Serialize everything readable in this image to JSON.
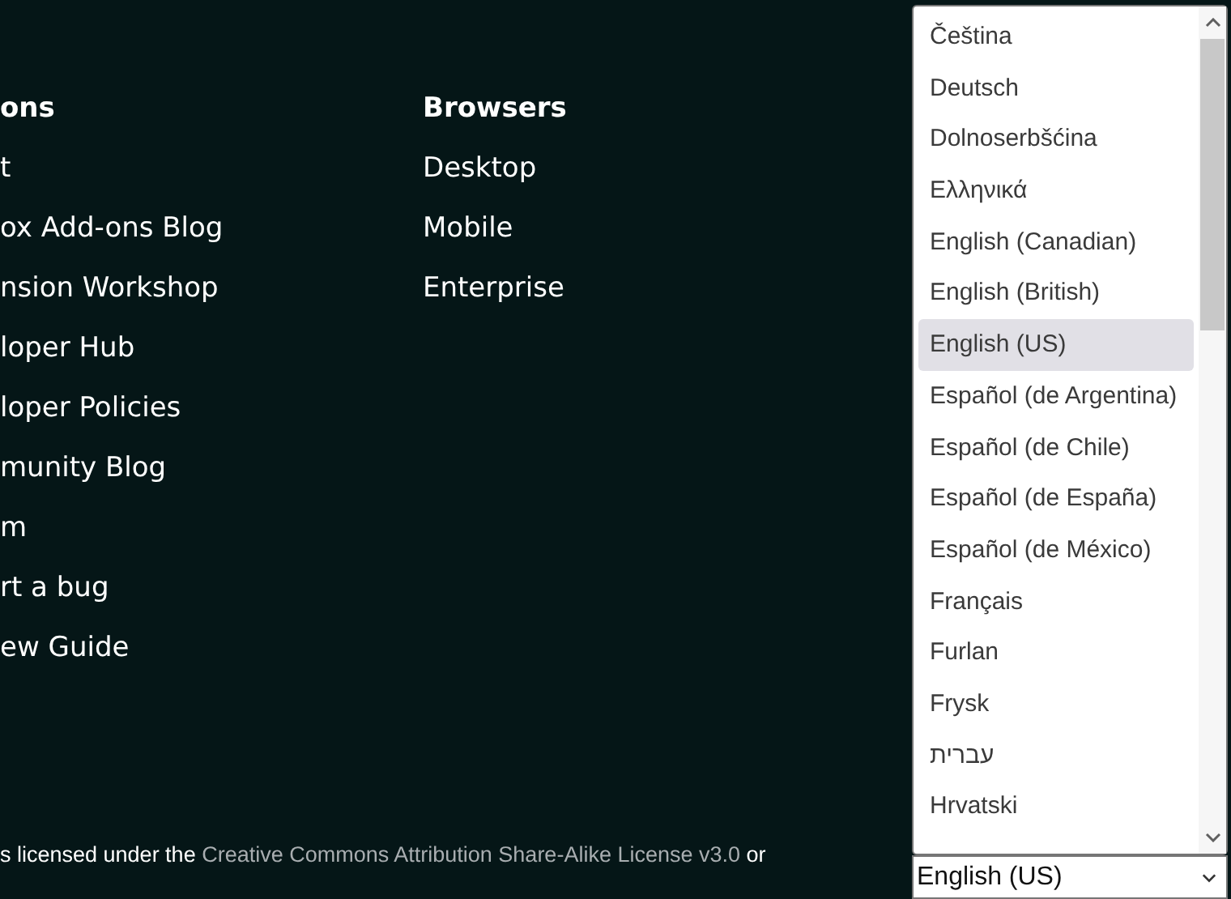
{
  "footer_columns": [
    {
      "heading": "ons",
      "links": [
        "t",
        "ox Add-ons Blog",
        "nsion Workshop",
        "loper Hub",
        "loper Policies",
        "munity Blog",
        "m",
        "rt a bug",
        "ew Guide"
      ]
    },
    {
      "heading": "Browsers",
      "links": [
        "Desktop",
        "Mobile",
        "Enterprise"
      ]
    }
  ],
  "license": {
    "before": "s licensed under the",
    "link": "Creative Commons Attribution Share-Alike License v3.0",
    "after": "or"
  },
  "language_dropdown": {
    "options": [
      {
        "label": "Čeština",
        "selected": false
      },
      {
        "label": "Deutsch",
        "selected": false
      },
      {
        "label": "Dolnoserbšćina",
        "selected": false
      },
      {
        "label": "Ελληνικά",
        "selected": false
      },
      {
        "label": "English (Canadian)",
        "selected": false
      },
      {
        "label": "English (British)",
        "selected": false
      },
      {
        "label": "English (US)",
        "selected": true
      },
      {
        "label": "Español (de Argentina)",
        "selected": false
      },
      {
        "label": "Español (de Chile)",
        "selected": false
      },
      {
        "label": "Español (de España)",
        "selected": false
      },
      {
        "label": "Español (de México)",
        "selected": false
      },
      {
        "label": "Français",
        "selected": false
      },
      {
        "label": "Furlan",
        "selected": false
      },
      {
        "label": "Frysk",
        "selected": false
      },
      {
        "label": "עברית",
        "selected": false
      },
      {
        "label": "Hrvatski",
        "selected": false
      }
    ],
    "value": "English (US)"
  }
}
